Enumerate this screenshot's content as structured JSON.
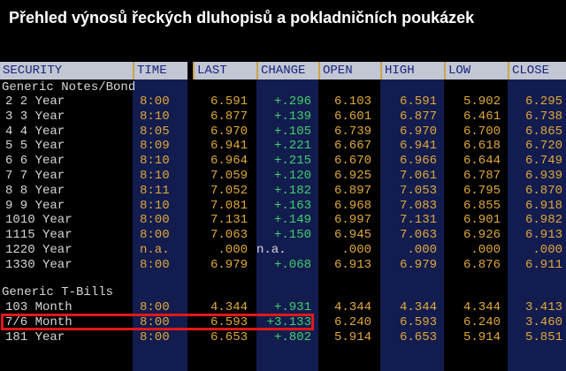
{
  "title": "Přehled výnosů řeckých dluhopisů a pokladničních poukázek",
  "columns": [
    "SECURITY",
    "TIME",
    "LAST",
    "CHANGE",
    "OPEN",
    "HIGH",
    "LOW",
    "CLOSE"
  ],
  "sections": {
    "notes": "Generic Notes/Bond",
    "bills": "Generic T-Bills"
  },
  "notes_rows": [
    {
      "security": "2 2 Year",
      "time": "8:00",
      "last": "6.591",
      "change": "+.296",
      "open": "6.103",
      "high": "6.591",
      "low": "5.902",
      "close": "6.295"
    },
    {
      "security": "3 3 Year",
      "time": "8:10",
      "last": "6.877",
      "change": "+.139",
      "open": "6.601",
      "high": "6.877",
      "low": "6.461",
      "close": "6.738"
    },
    {
      "security": "4 4 Year",
      "time": "8:05",
      "last": "6.970",
      "change": "+.105",
      "open": "6.739",
      "high": "6.970",
      "low": "6.700",
      "close": "6.865"
    },
    {
      "security": "5 5 Year",
      "time": "8:09",
      "last": "6.941",
      "change": "+.221",
      "open": "6.667",
      "high": "6.941",
      "low": "6.618",
      "close": "6.720"
    },
    {
      "security": "6 6 Year",
      "time": "8:10",
      "last": "6.964",
      "change": "+.215",
      "open": "6.670",
      "high": "6.966",
      "low": "6.644",
      "close": "6.749"
    },
    {
      "security": "7 7 Year",
      "time": "8:10",
      "last": "7.059",
      "change": "+.120",
      "open": "6.925",
      "high": "7.061",
      "low": "6.787",
      "close": "6.939"
    },
    {
      "security": "8 8 Year",
      "time": "8:11",
      "last": "7.052",
      "change": "+.182",
      "open": "6.897",
      "high": "7.053",
      "low": "6.795",
      "close": "6.870"
    },
    {
      "security": "9 9 Year",
      "time": "8:10",
      "last": "7.081",
      "change": "+.163",
      "open": "6.968",
      "high": "7.083",
      "low": "6.855",
      "close": "6.918"
    },
    {
      "security": "1010 Year",
      "time": "8:00",
      "last": "7.131",
      "change": "+.149",
      "open": "6.997",
      "high": "7.131",
      "low": "6.901",
      "close": "6.982"
    },
    {
      "security": "1115 Year",
      "time": "8:00",
      "last": "7.063",
      "change": "+.150",
      "open": "6.945",
      "high": "7.063",
      "low": "6.926",
      "close": "6.913"
    },
    {
      "security": "1220 Year",
      "time": "n.a.",
      "last": ".000",
      "change": "n.a.",
      "open": ".000",
      "high": ".000",
      "low": ".000",
      "close": ".000"
    },
    {
      "security": "1330 Year",
      "time": "8:00",
      "last": "6.979",
      "change": "+.068",
      "open": "6.913",
      "high": "6.979",
      "low": "6.876",
      "close": "6.911"
    }
  ],
  "bills_rows": [
    {
      "security": "103 Month",
      "time": "8:00",
      "last": "4.344",
      "change": "+.931",
      "open": "4.344",
      "high": "4.344",
      "low": "4.344",
      "close": "3.413"
    },
    {
      "security": "7/6 Month",
      "time": "8:00",
      "last": "6.593",
      "change": "+3.133",
      "open": "6.240",
      "high": "6.593",
      "low": "6.240",
      "close": "3.460"
    },
    {
      "security": "181 Year",
      "time": "8:00",
      "last": "6.653",
      "change": "+.802",
      "open": "5.914",
      "high": "6.653",
      "low": "5.914",
      "close": "5.851"
    }
  ]
}
